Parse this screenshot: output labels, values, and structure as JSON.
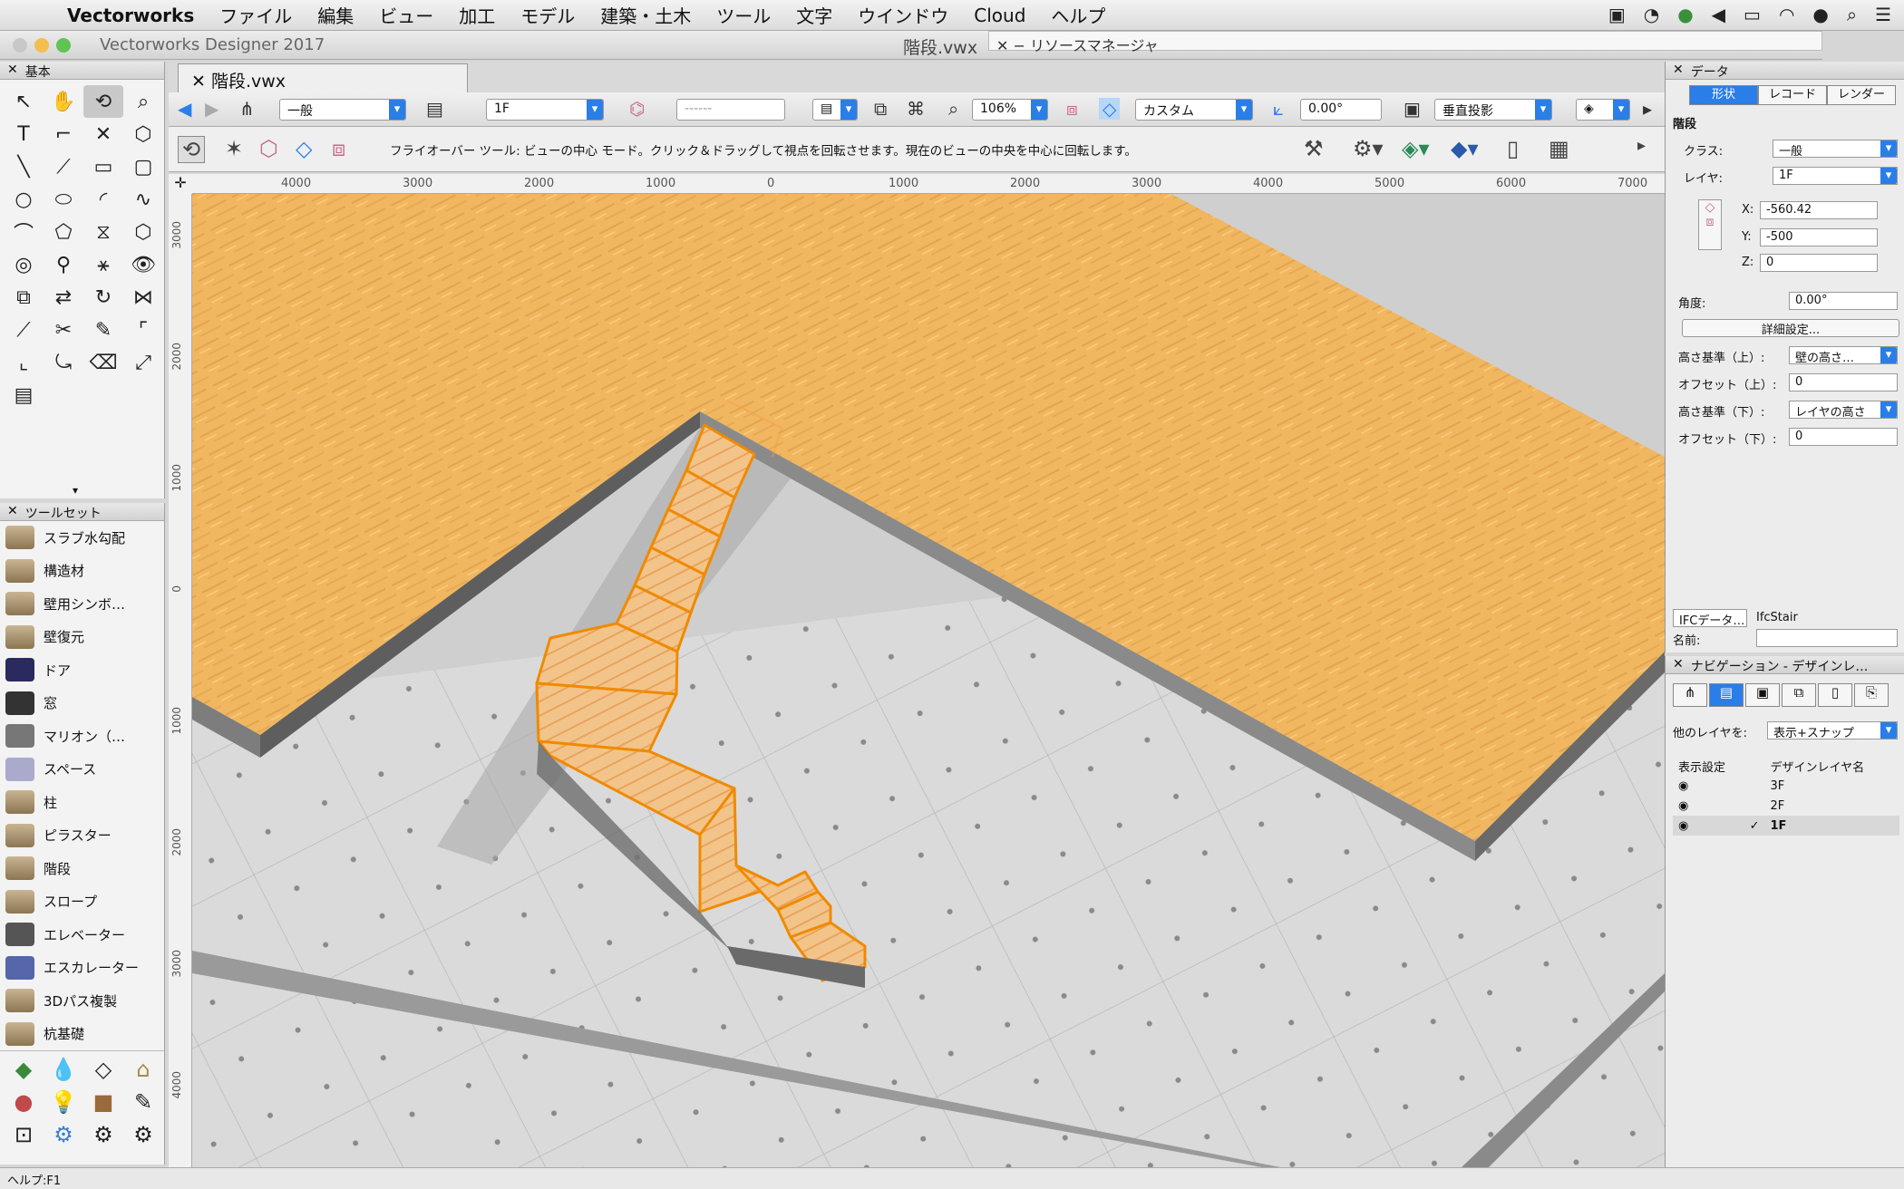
{
  "menubar": {
    "app": "Vectorworks",
    "items": [
      "ファイル",
      "編集",
      "ビュー",
      "加工",
      "モデル",
      "建築・土木",
      "ツール",
      "文字",
      "ウインドウ",
      "Cloud",
      "ヘルプ"
    ]
  },
  "window": {
    "title": "Vectorworks Designer 2017",
    "document": "階段.vwx",
    "resource_manager": "リソースマネージャ"
  },
  "tab": {
    "label": "階段.vwx"
  },
  "viewbar": {
    "class": "一般",
    "layer": "1F",
    "blank": "------",
    "zoom": "106%",
    "view": "カスタム",
    "angle": "0.00°",
    "projection": "垂直投影"
  },
  "modebar": {
    "help": "フライオーバー ツール: ビューの中心 モード。クリック＆ドラッグして視点を回転させます。現在のビューの中央を中心に回転します。"
  },
  "palettes": {
    "basic": "基本",
    "toolset": "ツールセット"
  },
  "toolset": {
    "items": [
      "スラブ水勾配",
      "構造材",
      "壁用シンボ…",
      "壁復元",
      "ドア",
      "窓",
      "マリオン（…",
      "スペース",
      "柱",
      "ピラスター",
      "階段",
      "スロープ",
      "エレベーター",
      "エスカレーター",
      "3Dパス複製",
      "杭基礎"
    ]
  },
  "hruler": {
    "labels": [
      "4000",
      "3000",
      "2000",
      "1000",
      "0",
      "1000",
      "2000",
      "3000",
      "4000",
      "5000",
      "6000",
      "7000"
    ]
  },
  "vruler": {
    "labels": [
      "3000",
      "2000",
      "1000",
      "0",
      "1000",
      "2000",
      "3000",
      "4000"
    ]
  },
  "obj": {
    "title": "データ",
    "tabs": [
      "形状",
      "レコード",
      "レンダー"
    ],
    "type": "階段",
    "class_label": "クラス:",
    "class": "一般",
    "layer_label": "レイヤ:",
    "layer": "1F",
    "x_label": "X:",
    "x": "-560.42",
    "y_label": "Y:",
    "y": "-500",
    "z_label": "Z:",
    "z": "0",
    "angle_label": "角度:",
    "angle": "0.00°",
    "detail": "詳細設定...",
    "top_label": "高さ基準（上）:",
    "top": "壁の高さ…",
    "offset_top_label": "オフセット（上）:",
    "offset_top": "0",
    "bottom_label": "高さ基準（下）:",
    "bottom": "レイヤの高さ",
    "offset_bottom_label": "オフセット（下）:",
    "offset_bottom": "0",
    "ifc_button": "IFCデータ…",
    "ifc_value": "IfcStair",
    "name_label": "名前:"
  },
  "nav": {
    "title": "ナビゲーション - デザインレ…",
    "other_layers_label": "他のレイヤを:",
    "other_layers": "表示+スナップ",
    "col_visibility": "表示設定",
    "col_name": "デザインレイヤ名",
    "layers": [
      {
        "name": "3F",
        "check": ""
      },
      {
        "name": "2F",
        "check": ""
      },
      {
        "name": "1F",
        "check": "✓"
      }
    ]
  },
  "status": {
    "text": "ヘルプ:F1"
  }
}
